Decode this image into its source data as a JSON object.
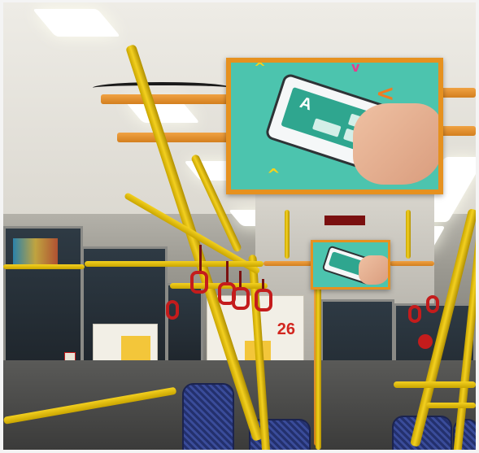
{
  "scene": {
    "description_tag": "bus-interior-photo",
    "colors": {
      "handrail": "#f3d020",
      "monitor_frame": "#e6911f",
      "screen_background": "#4cc4ae",
      "strap_handle": "#c41c1c",
      "seat": "#2b3a80"
    }
  },
  "icons": {
    "monitor_large": "display-icon",
    "monitor_small": "display-icon",
    "seat": "seat-icon",
    "handle": "grab-handle-icon"
  },
  "posters": {
    "route_number": "26"
  },
  "screen": {
    "app_letter": "A"
  }
}
